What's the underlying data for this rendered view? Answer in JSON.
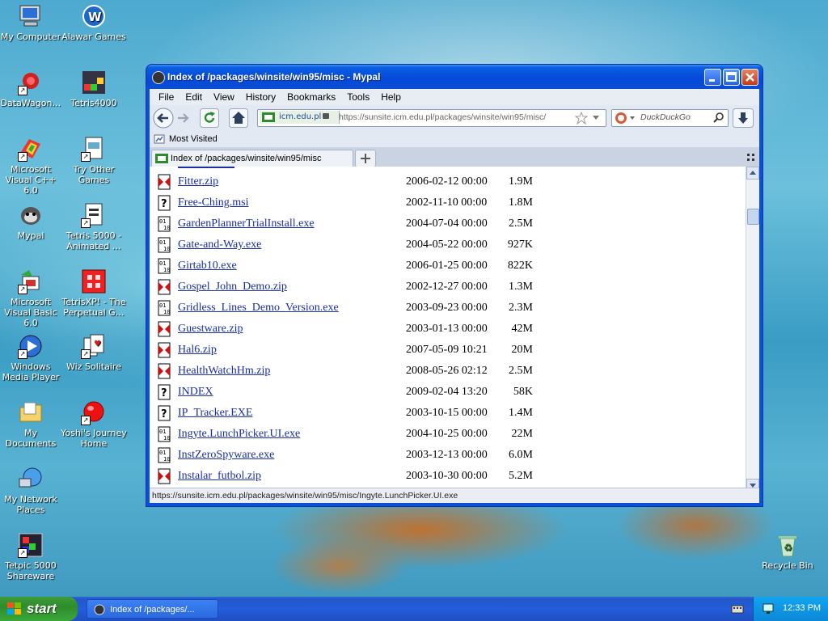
{
  "desktop": {
    "icons_left": [
      {
        "label": "My Computer",
        "icon": "my-computer-icon"
      },
      {
        "label": "DataWagon…",
        "icon": "datawagon-icon"
      },
      {
        "label": "Microsoft Visual C++ 6.0",
        "icon": "visual-cpp-icon"
      },
      {
        "label": "Mypal",
        "icon": "mypal-icon"
      },
      {
        "label": "Microsoft Visual Basic 6.0",
        "icon": "visual-basic-icon"
      },
      {
        "label": "Windows Media Player",
        "icon": "media-player-icon"
      },
      {
        "label": "My Documents",
        "icon": "my-documents-icon"
      },
      {
        "label": "My Network Places",
        "icon": "network-places-icon"
      },
      {
        "label": "Tetpic 5000 Shareware",
        "icon": "tetpic-icon"
      }
    ],
    "icons_right_col": [
      {
        "label": "Alawar Games",
        "icon": "alawar-icon"
      },
      {
        "label": "Tetris4000",
        "icon": "tetris4000-icon"
      },
      {
        "label": "Try Other Games",
        "icon": "try-games-icon"
      },
      {
        "label": "Tetris 5000 - Animated …",
        "icon": "tetris5000-icon"
      },
      {
        "label": "TetrisXP! - The Perpetual G…",
        "icon": "tetrisxp-icon"
      },
      {
        "label": "Wiz Solitaire",
        "icon": "solitaire-icon"
      },
      {
        "label": "Yoshi's Journey Home",
        "icon": "yoshi-icon"
      }
    ],
    "recycle_bin": "Recycle Bin"
  },
  "window": {
    "title": "Index of /packages/winsite/win95/misc - Mypal",
    "menu": [
      "File",
      "Edit",
      "View",
      "History",
      "Bookmarks",
      "Tools",
      "Help"
    ],
    "site_identity": "icm.edu.pl",
    "url": "https://sunsite.icm.edu.pl/packages/winsite/win95/misc/",
    "search_placeholder": "DuckDuckGo",
    "bookmark_item": "Most Visited",
    "tab_title": "Index of /packages/winsite/win95/misc",
    "status_url": "https://sunsite.icm.edu.pl/packages/winsite/win95/misc/Ingyte.LunchPicker.UI.exe"
  },
  "files": [
    {
      "name": "Fitter.zip",
      "date": "2006-02-12 00:00",
      "size": "1.9M",
      "icon": "zip"
    },
    {
      "name": "Free-Ching.msi",
      "date": "2002-11-10 00:00",
      "size": "1.8M",
      "icon": "unknown"
    },
    {
      "name": "GardenPlannerTrialInstall.exe",
      "date": "2004-07-04 00:00",
      "size": "2.5M",
      "icon": "binary"
    },
    {
      "name": "Gate-and-Way.exe",
      "date": "2004-05-22 00:00",
      "size": "927K",
      "icon": "binary"
    },
    {
      "name": "Girtab10.exe",
      "date": "2006-01-25 00:00",
      "size": "822K",
      "icon": "binary"
    },
    {
      "name": "Gospel_John_Demo.zip",
      "date": "2002-12-27 00:00",
      "size": "1.3M",
      "icon": "zip"
    },
    {
      "name": "Gridless_Lines_Demo_Version.exe",
      "date": "2003-09-23 00:00",
      "size": "2.3M",
      "icon": "binary"
    },
    {
      "name": "Guestware.zip",
      "date": "2003-01-13 00:00",
      "size": "42M",
      "icon": "zip"
    },
    {
      "name": "Hal6.zip",
      "date": "2007-05-09 10:21",
      "size": "20M",
      "icon": "zip"
    },
    {
      "name": "HealthWatchHm.zip",
      "date": "2008-05-26 02:12",
      "size": "2.5M",
      "icon": "zip"
    },
    {
      "name": "INDEX",
      "date": "2009-02-04 13:20",
      "size": "58K",
      "icon": "unknown"
    },
    {
      "name": "IP_Tracker.EXE",
      "date": "2003-10-15 00:00",
      "size": "1.4M",
      "icon": "unknown"
    },
    {
      "name": "Ingyte.LunchPicker.UI.exe",
      "date": "2004-10-25 00:00",
      "size": "22M",
      "icon": "binary"
    },
    {
      "name": "InstZeroSpyware.exe",
      "date": "2003-12-13 00:00",
      "size": "6.0M",
      "icon": "binary"
    },
    {
      "name": "Instalar_futbol.zip",
      "date": "2003-10-30 00:00",
      "size": "5.2M",
      "icon": "zip"
    }
  ],
  "taskbar": {
    "start_label": "start",
    "task_button": "Index of /packages/...",
    "clock": "12:33 PM"
  }
}
